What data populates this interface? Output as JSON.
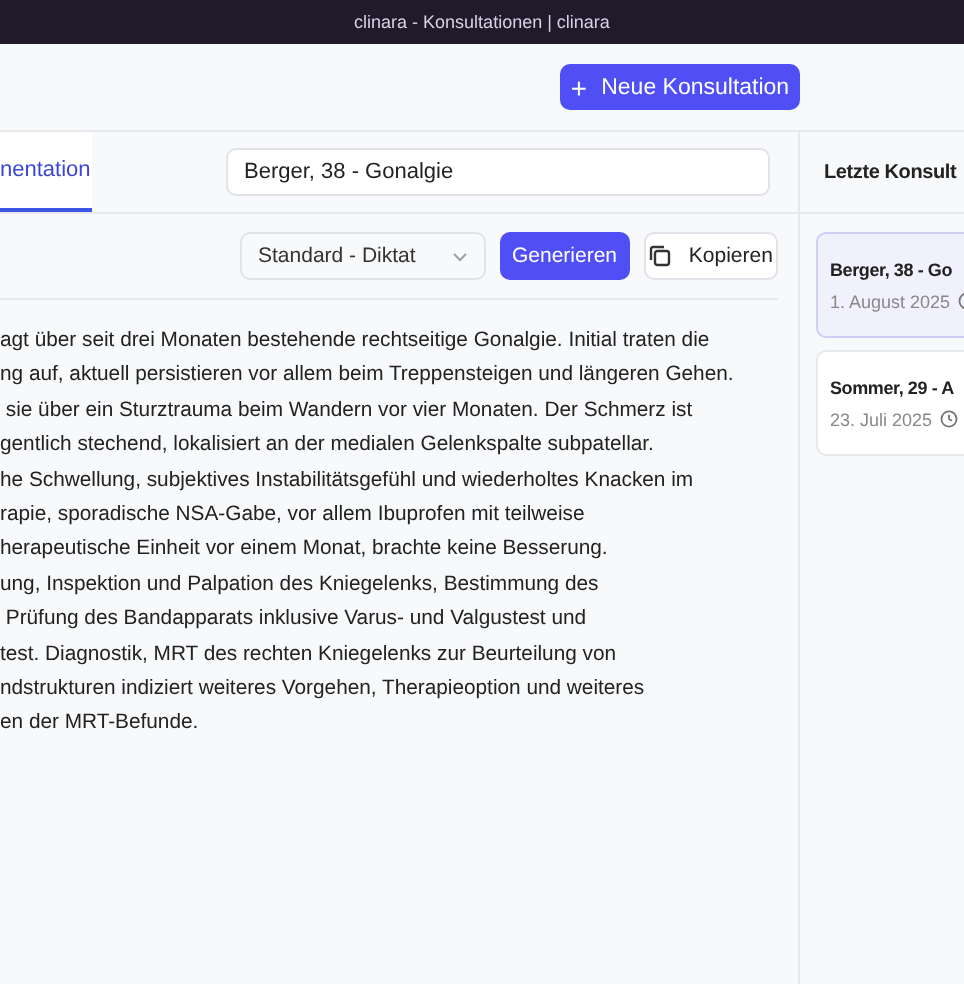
{
  "window": {
    "title": "clinara - Konsultationen | clinara"
  },
  "header": {
    "new_button": {
      "icon": "+",
      "label": "Neue Konsultation"
    }
  },
  "tabs": [
    {
      "label": "nentation",
      "selected": true
    }
  ],
  "title_field": {
    "value": "Berger, 38 - Gonalgie"
  },
  "toolbar": {
    "template_select": {
      "value": "Standard - Diktat"
    },
    "generate_button": "Generieren",
    "copy_button": "Kopieren"
  },
  "document_lines": [
    "agt über seit drei Monaten bestehende rechtseitige Gonalgie. Initial traten die",
    "ng auf, aktuell persistieren vor allem beim Treppensteigen und längeren Gehen.",
    " sie über ein Sturztrauma beim Wandern vor vier Monaten. Der Schmerz ist",
    "gentlich stechend, lokalisiert an der medialen Gelenkspalte subpatellar.",
    "he Schwellung, subjektives Instabilitätsgefühl und wiederholtes Knacken im",
    "rapie, sporadische NSA-Gabe, vor allem Ibuprofen mit teilweise",
    "herapeutische Einheit vor einem Monat, brachte keine Besserung.",
    "ung, Inspektion und Palpation des Kniegelenks, Bestimmung des",
    " Prüfung des Bandapparats inklusive Varus- und Valgustest und",
    "test. Diagnostik, MRT des rechten Kniegelenks zur Beurteilung von",
    "ndstrukturen indiziert weiteres Vorgehen, Therapieoption und weiteres",
    "en der MRT-Befunde."
  ],
  "recent": {
    "title": "Letzte Konsult",
    "items": [
      {
        "name": "Berger, 38 - Go",
        "date": "1. August 2025",
        "selected": true
      },
      {
        "name": "Sommer, 29 - A",
        "date": "23. Juli 2025",
        "selected": false
      }
    ]
  }
}
